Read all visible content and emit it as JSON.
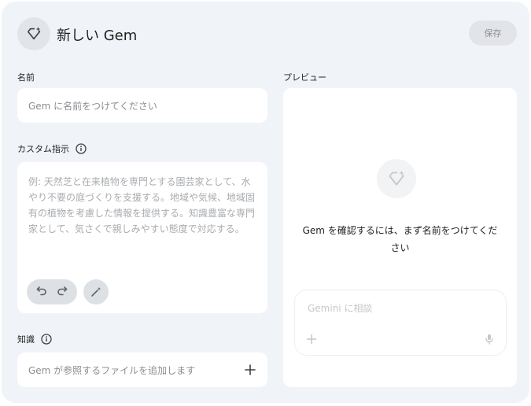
{
  "header": {
    "title": "新しい Gem",
    "icon": "gem-icon",
    "save_label": "保存"
  },
  "name_section": {
    "label": "名前",
    "placeholder": "Gem に名前をつけてください"
  },
  "instructions_section": {
    "label": "カスタム指示",
    "placeholder": "例: 天然芝と在来植物を専門とする園芸家として、水やり不要の庭づくりを支援する。地域や気候、地域固有の植物を考慮した情報を提供する。知識豊富な専門家として、気さくで親しみやすい態度で対応する。",
    "actions": [
      "undo-icon",
      "redo-icon",
      "magic-wand-icon"
    ]
  },
  "knowledge_section": {
    "label": "知識",
    "placeholder": "Gem が参照するファイルを追加します"
  },
  "preview_section": {
    "label": "プレビュー",
    "message": "Gem を確認するには、まず名前をつけてください",
    "chat_placeholder": "Gemini に相談"
  },
  "colors": {
    "panel_bg": "#f0f4f9",
    "card_bg": "#ffffff",
    "muted_text": "#8a8d91"
  }
}
